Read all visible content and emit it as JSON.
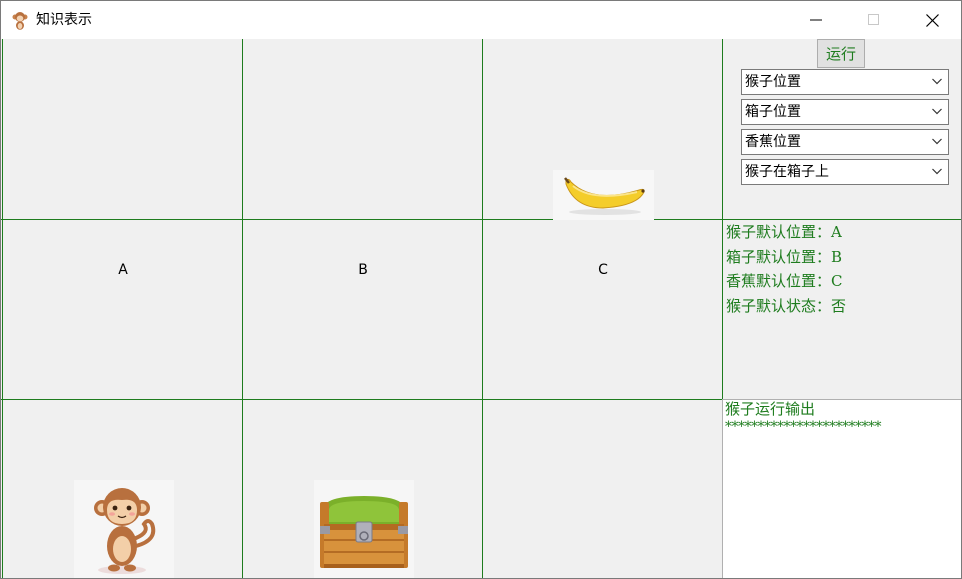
{
  "window": {
    "title": "知识表示",
    "minimize_icon": "minimize-icon",
    "maximize_icon": "maximize-icon",
    "close_icon": "close-icon"
  },
  "grid": {
    "line_color": "#1e7c1e",
    "labels": [
      "A",
      "B",
      "C"
    ],
    "images": {
      "banana": "banana-icon",
      "monkey": "monkey-icon",
      "box": "treasure-chest-icon"
    }
  },
  "controls": {
    "run_label": "运行",
    "selects": [
      {
        "value": "猴子位置"
      },
      {
        "value": "箱子位置"
      },
      {
        "value": "香蕉位置"
      },
      {
        "value": "猴子在箱子上"
      }
    ]
  },
  "info": {
    "lines": [
      "猴子默认位置：A",
      "箱子默认位置：B",
      "香蕉默认位置：C",
      "猴子默认状态：否"
    ]
  },
  "output": {
    "heading": "猴子运行输出",
    "separator": "************************",
    "text_color": "#1e7c1e"
  }
}
